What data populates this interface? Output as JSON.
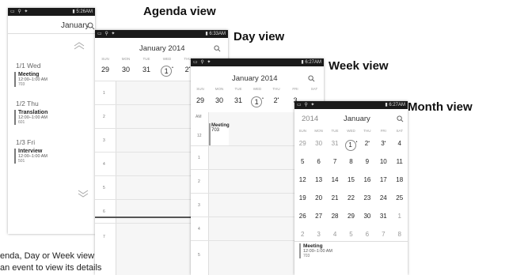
{
  "captions": {
    "agenda": "Agenda view",
    "day": "Day view",
    "week": "Week view",
    "month": "Month view"
  },
  "status": {
    "agenda_time": "5:26",
    "day_time": "6:33",
    "week_time": "6:27",
    "month_time": "6:27",
    "ampm": "AM"
  },
  "agenda": {
    "title": "January",
    "groups": [
      {
        "date": "1/1  Wed",
        "event": "Meeting",
        "time": "12:00–1:00 AM",
        "loc": "703"
      },
      {
        "date": "1/2  Thu",
        "event": "Translation",
        "time": "12:00–1:00 AM",
        "loc": "601"
      },
      {
        "date": "1/3  Fri",
        "event": "Interview",
        "time": "12:00–1:00 AM",
        "loc": "501"
      }
    ]
  },
  "day": {
    "title": "January 2014",
    "dows": [
      "SUN",
      "MON",
      "TUE",
      "WED",
      "THU"
    ],
    "dates": [
      "29",
      "30",
      "31",
      "1",
      "2"
    ],
    "hours": [
      "1",
      "2",
      "3",
      "4",
      "5",
      "6",
      "7"
    ]
  },
  "week": {
    "title": "January 2014",
    "dows": [
      "SUN",
      "MON",
      "TUE",
      "WED",
      "THU",
      "FRI",
      "SAT"
    ],
    "dates": [
      "29",
      "30",
      "31",
      "1",
      "2",
      "3"
    ],
    "ampm": "AM",
    "hours": [
      "12",
      "1",
      "2",
      "3",
      "4",
      "5"
    ],
    "event": "Meeting",
    "event_loc": "703"
  },
  "month": {
    "year": "2014",
    "title": "January",
    "dows": [
      "SUN",
      "MON",
      "TUE",
      "WED",
      "THU",
      "FRI",
      "SAT"
    ],
    "weeks": [
      [
        "29",
        "30",
        "31",
        "1",
        "2",
        "3",
        "4"
      ],
      [
        "5",
        "6",
        "7",
        "8",
        "9",
        "10",
        "11"
      ],
      [
        "12",
        "13",
        "14",
        "15",
        "16",
        "17",
        "18"
      ],
      [
        "19",
        "20",
        "21",
        "22",
        "23",
        "24",
        "25"
      ],
      [
        "26",
        "27",
        "28",
        "29",
        "30",
        "31",
        "1"
      ],
      [
        "2",
        "3",
        "4",
        "5",
        "6",
        "7",
        "8"
      ]
    ],
    "event": "Meeting",
    "event_time": "12:00–1:00 AM",
    "event_loc": "703"
  },
  "bottom_text": {
    "line1": "enda, Day or Week view",
    "line2": "an event to view its details"
  }
}
